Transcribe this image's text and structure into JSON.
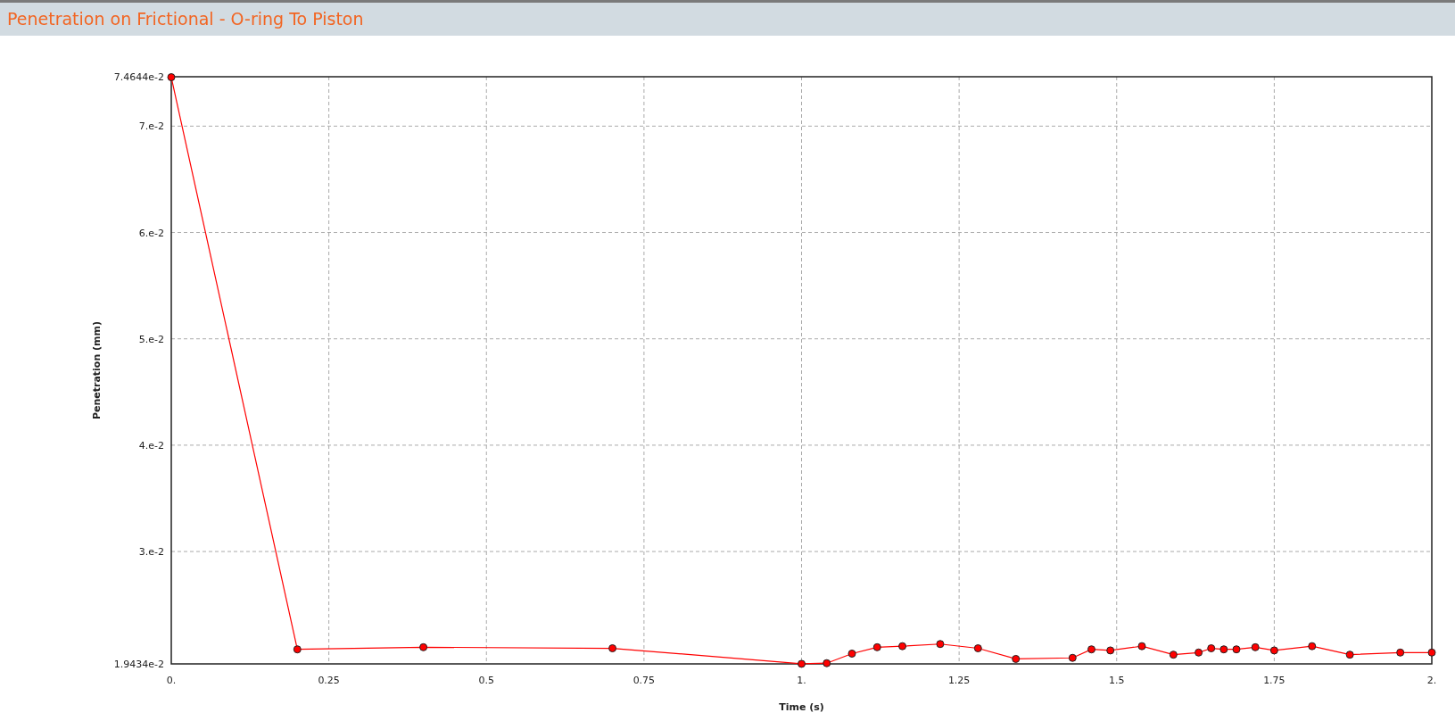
{
  "window": {
    "title": "Penetration on Frictional - O-ring To Piston"
  },
  "chart": {
    "chart_data": {
      "type": "line",
      "xlabel": "Time (s)",
      "ylabel": "Penetration (mm)",
      "x": [
        0,
        0.2,
        0.4,
        0.7,
        1.0,
        1.04,
        1.08,
        1.12,
        1.16,
        1.22,
        1.28,
        1.34,
        1.43,
        1.46,
        1.49,
        1.54,
        1.59,
        1.63,
        1.65,
        1.67,
        1.69,
        1.72,
        1.75,
        1.81,
        1.87,
        1.95,
        2.0
      ],
      "grid": true,
      "series": [
        {
          "color": "#ff0000",
          "marker": "circle",
          "values": [
            0.0746,
            0.0208,
            0.021,
            0.0209,
            0.01944,
            0.0195,
            0.0204,
            0.021,
            0.0211,
            0.0213,
            0.0209,
            0.0199,
            0.02,
            0.0208,
            0.0207,
            0.0211,
            0.0203,
            0.0205,
            0.0209,
            0.0208,
            0.0208,
            0.021,
            0.0207,
            0.0211,
            0.0203,
            0.0205,
            0.0205
          ]
        }
      ],
      "xlim": [
        0,
        2
      ],
      "ylim": [
        0.019434,
        0.074644
      ],
      "xticks": [
        {
          "value": 0,
          "label": "0."
        },
        {
          "value": 0.25,
          "label": "0.25"
        },
        {
          "value": 0.5,
          "label": "0.5"
        },
        {
          "value": 0.75,
          "label": "0.75"
        },
        {
          "value": 1,
          "label": "1."
        },
        {
          "value": 1.25,
          "label": "1.25"
        },
        {
          "value": 1.5,
          "label": "1.5"
        },
        {
          "value": 1.75,
          "label": "1.75"
        },
        {
          "value": 2,
          "label": "2."
        }
      ],
      "yticks": [
        {
          "value": 0.019434,
          "label": "1.9434e-2"
        },
        {
          "value": 0.03,
          "label": "3.e-2"
        },
        {
          "value": 0.04,
          "label": "4.e-2"
        },
        {
          "value": 0.05,
          "label": "5.e-2"
        },
        {
          "value": 0.06,
          "label": "6.e-2"
        },
        {
          "value": 0.07,
          "label": "7.e-2"
        },
        {
          "value": 0.074644,
          "label": "7.4644e-2"
        }
      ]
    }
  }
}
